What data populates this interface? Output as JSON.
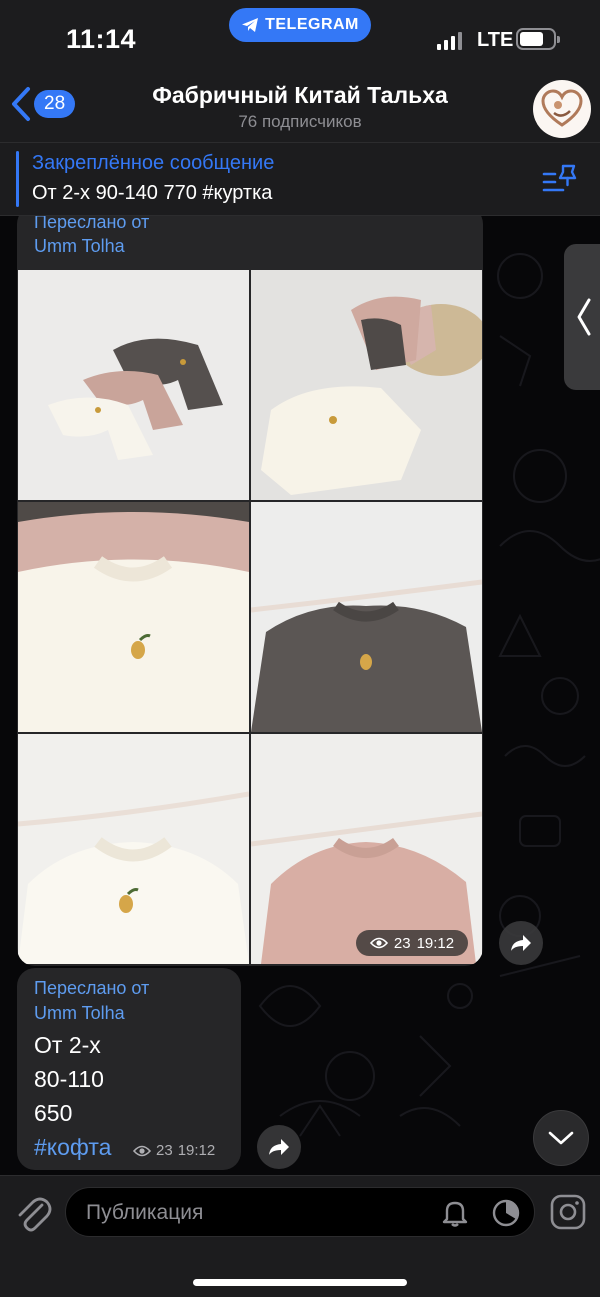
{
  "status_bar": {
    "time": "11:14",
    "app_pill": "TELEGRAM",
    "network": "LTE",
    "battery_level": 0.72
  },
  "header": {
    "back_count": "28",
    "title": "Фабричный Китай Тальха",
    "subtitle": "76 подписчиков",
    "avatar_icon": "heart-logo"
  },
  "pinned": {
    "title": "Закреплённое сообщение",
    "text": "От 2-х 90-140 770 #куртка"
  },
  "messages": [
    {
      "forwarded_label": "Переслано от",
      "forwarded_from": "Umm Tolha",
      "photos": [
        "sweatshirts-group",
        "sweatshirts-basket",
        "sweatshirt-pink-cream",
        "sweatshirt-gray",
        "sweatshirt-cream",
        "sweatshirt-pink"
      ],
      "views": "23",
      "time": "19:12"
    },
    {
      "forwarded_label": "Переслано от",
      "forwarded_from": "Umm Tolha",
      "lines": [
        "От 2-х",
        "80-110",
        "650"
      ],
      "hashtag": "#кофта",
      "views": "23",
      "time": "19:12"
    }
  ],
  "composer": {
    "placeholder": "Публикация"
  },
  "colors": {
    "accent": "#3478f6",
    "link": "#5e9cf0",
    "bubble": "#262628",
    "bar": "#1c1c1e"
  }
}
